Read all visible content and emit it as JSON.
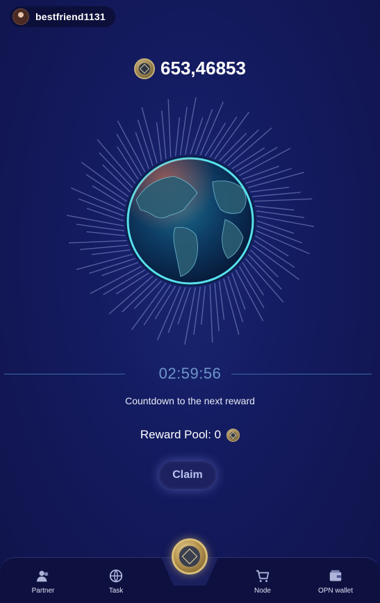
{
  "user": {
    "username": "bestfriend1131"
  },
  "balance": {
    "value": "653,46853"
  },
  "timer": {
    "value": "02:59:56",
    "label": "Countdown to the next reward"
  },
  "reward_pool": {
    "label": "Reward Pool: 0"
  },
  "claim": {
    "label": "Claim"
  },
  "nav": {
    "partner": "Partner",
    "task": "Task",
    "node": "Node",
    "wallet": "OPN wallet"
  },
  "colors": {
    "background": "#121755",
    "accent": "#6e96c8",
    "coin_gold": "#c8b27a"
  }
}
